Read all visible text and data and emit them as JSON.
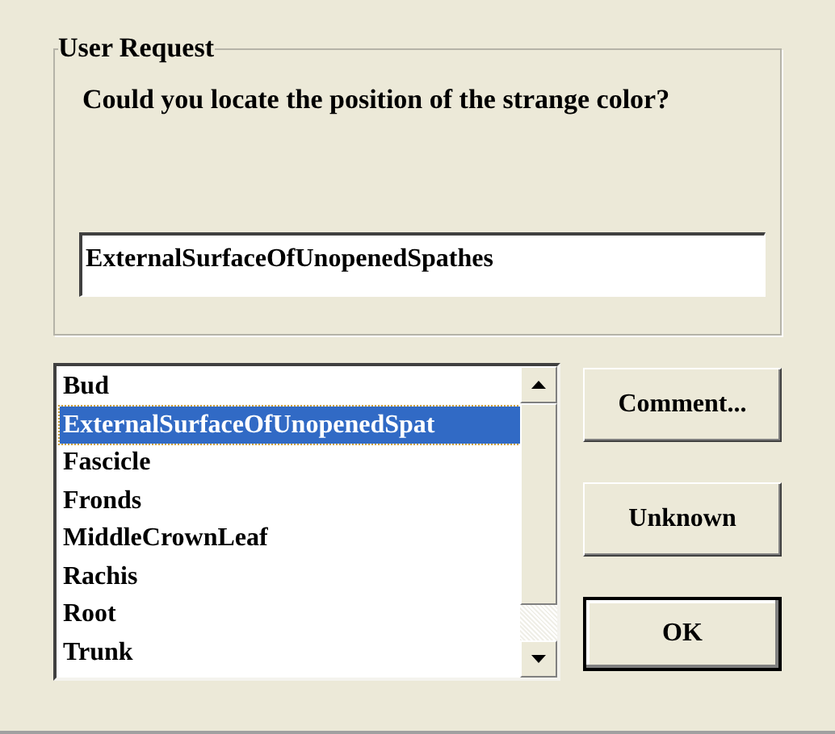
{
  "group": {
    "title": "User Request",
    "question": "Could you locate the position of the strange color?",
    "answer": {
      "value": "ExternalSurfaceOfUnopenedSpathes"
    }
  },
  "list": {
    "items": [
      {
        "label": "Bud",
        "selected": false
      },
      {
        "label": "ExternalSurfaceOfUnopenedSpat",
        "selected": true
      },
      {
        "label": "Fascicle",
        "selected": false
      },
      {
        "label": "Fronds",
        "selected": false
      },
      {
        "label": "MiddleCrownLeaf",
        "selected": false
      },
      {
        "label": "Rachis",
        "selected": false
      },
      {
        "label": "Root",
        "selected": false
      },
      {
        "label": "Trunk",
        "selected": false
      }
    ]
  },
  "buttons": [
    {
      "label": "Comment...",
      "default": false
    },
    {
      "label": "Unknown",
      "default": false
    },
    {
      "label": "OK",
      "default": true
    }
  ]
}
